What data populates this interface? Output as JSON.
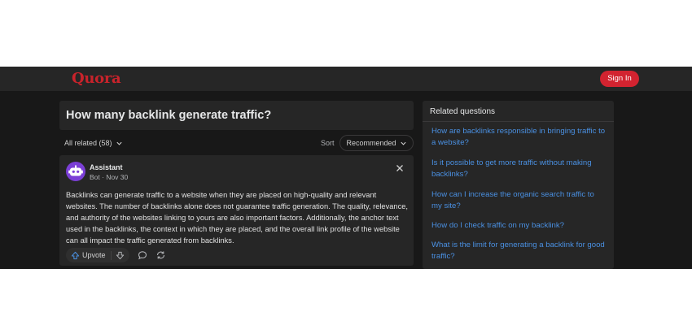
{
  "header": {
    "logo": "Quora",
    "signin_label": "Sign In"
  },
  "question": {
    "title": "How many backlink generate traffic?"
  },
  "filters": {
    "all_related": "All related (58)",
    "sort_label": "Sort",
    "sort_value": "Recommended"
  },
  "answer": {
    "author": "Assistant",
    "meta": "Bot · Nov 30",
    "text": "Backlinks can generate traffic to a website when they are placed on high-quality and relevant websites. The number of backlinks alone does not guarantee traffic generation. The quality, relevance, and authority of the websites linking to yours are also important factors. Additionally, the anchor text used in the backlinks, the context in which they are placed, and the overall link profile of the website can all impact the traffic generated from backlinks.",
    "upvote_label": "Upvote"
  },
  "related": {
    "title": "Related questions",
    "items": [
      "How are backlinks responsible in bringing traffic to a website?",
      "Is it possible to get more traffic without making backlinks?",
      "How can I increase the organic search traffic to my site?",
      "How do I check traffic on my backlink?",
      "What is the limit for generating a backlink for good traffic?"
    ]
  },
  "colors": {
    "brand": "#c8232b",
    "link": "#4a90e2",
    "background": "#181818",
    "card": "#262626",
    "avatar": "#7b3fd6"
  },
  "icons": {
    "upvote": "upvote-arrow-icon",
    "downvote": "downvote-arrow-icon",
    "comment": "comment-icon",
    "share": "reshare-icon",
    "close": "close-icon",
    "chevron": "chevron-down-icon",
    "avatar": "bot-avatar-icon"
  }
}
